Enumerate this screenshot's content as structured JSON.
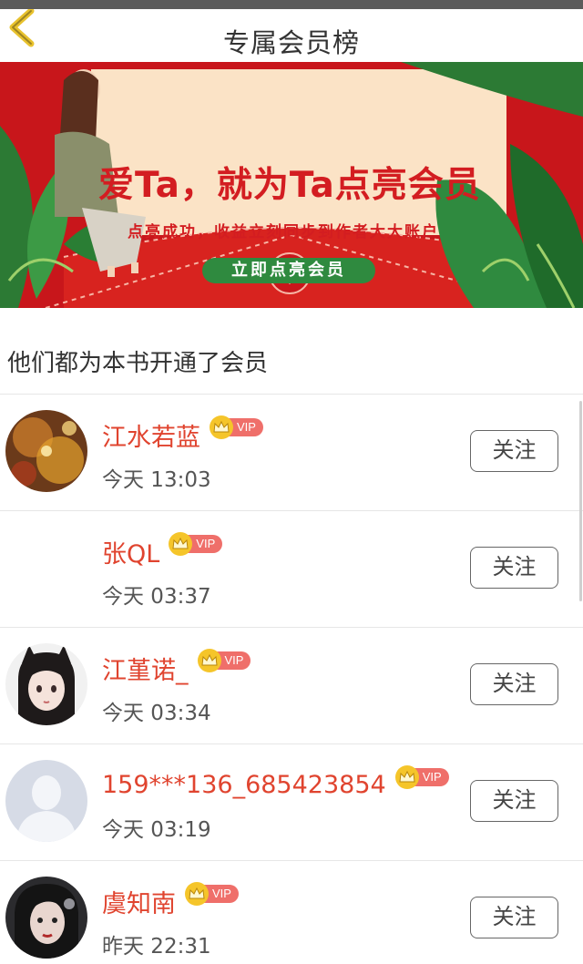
{
  "header": {
    "title": "专属会员榜"
  },
  "banner": {
    "headline": "爱Ta，就为Ta点亮会员",
    "subtitle": "点亮成功，收益立刻同步到作者大大账户",
    "cta_label": "立即点亮会员"
  },
  "section": {
    "title": "他们都为本书开通了会员"
  },
  "vip_label": "VIP",
  "follow_label": "关注",
  "members": [
    {
      "name": "江水若蓝",
      "time": "今天 13:03",
      "avatar": "photo-golden-bokeh"
    },
    {
      "name": "张QL",
      "time": "今天 03:37",
      "avatar": "none"
    },
    {
      "name": "江堇诺_",
      "time": "今天 03:34",
      "avatar": "anime-girl-cat-ears"
    },
    {
      "name": "159***136_685423854",
      "time": "今天 03:19",
      "avatar": "default-silhouette"
    },
    {
      "name": "虞知南",
      "time": "昨天 22:31",
      "avatar": "stylized-portrait"
    }
  ],
  "colors": {
    "accent_red": "#e0442f",
    "banner_red": "#c8161b",
    "vip_pink": "#ef6f6a",
    "crown_gold": "#f5c52a",
    "cta_green": "#2f8a3f"
  }
}
